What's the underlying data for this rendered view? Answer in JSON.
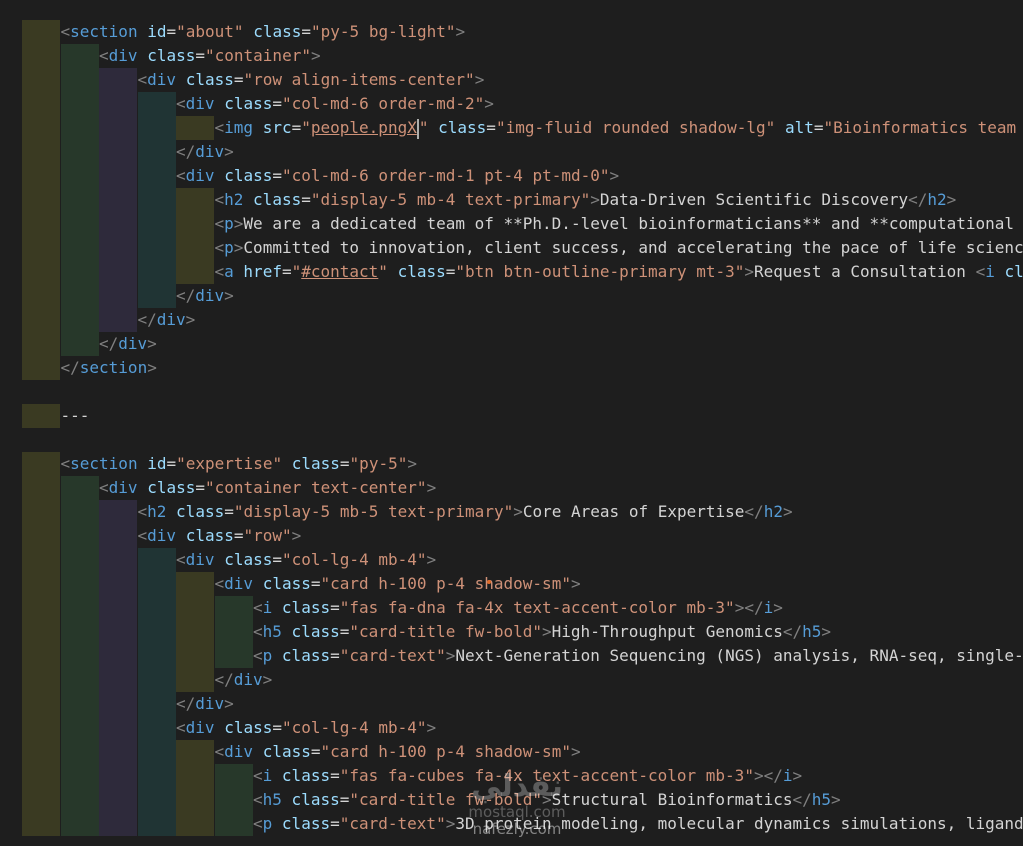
{
  "editor": {
    "lines": [
      {
        "indent": 0,
        "tokens": []
      },
      {
        "indent": 1,
        "tokens": [
          [
            "br",
            "<"
          ],
          [
            "tag",
            "section"
          ],
          [
            "txt",
            " "
          ],
          [
            "attr",
            "id"
          ],
          [
            "txt",
            "="
          ],
          [
            "str",
            "\"about\""
          ],
          [
            "txt",
            " "
          ],
          [
            "attr",
            "class"
          ],
          [
            "txt",
            "="
          ],
          [
            "str",
            "\"py-5 bg-light\""
          ],
          [
            "br",
            ">"
          ]
        ]
      },
      {
        "indent": 2,
        "tokens": [
          [
            "br",
            "<"
          ],
          [
            "tag",
            "div"
          ],
          [
            "txt",
            " "
          ],
          [
            "attr",
            "class"
          ],
          [
            "txt",
            "="
          ],
          [
            "str",
            "\"container\""
          ],
          [
            "br",
            ">"
          ]
        ]
      },
      {
        "indent": 3,
        "tokens": [
          [
            "br",
            "<"
          ],
          [
            "tag",
            "div"
          ],
          [
            "txt",
            " "
          ],
          [
            "attr",
            "class"
          ],
          [
            "txt",
            "="
          ],
          [
            "str",
            "\"row align-items-center\""
          ],
          [
            "br",
            ">"
          ]
        ]
      },
      {
        "indent": 4,
        "tokens": [
          [
            "br",
            "<"
          ],
          [
            "tag",
            "div"
          ],
          [
            "txt",
            " "
          ],
          [
            "attr",
            "class"
          ],
          [
            "txt",
            "="
          ],
          [
            "str",
            "\"col-md-6 order-md-2\""
          ],
          [
            "br",
            ">"
          ]
        ]
      },
      {
        "indent": 5,
        "tokens": [
          [
            "br",
            "<"
          ],
          [
            "tag",
            "img"
          ],
          [
            "txt",
            " "
          ],
          [
            "attr",
            "src"
          ],
          [
            "txt",
            "="
          ],
          [
            "str",
            "\""
          ],
          [
            "stru",
            "people.pngX"
          ],
          [
            "cursor",
            ""
          ],
          [
            "str",
            "\""
          ],
          [
            "txt",
            " "
          ],
          [
            "attr",
            "class"
          ],
          [
            "txt",
            "="
          ],
          [
            "str",
            "\"img-fluid rounded shadow-lg\""
          ],
          [
            "txt",
            " "
          ],
          [
            "attr",
            "alt"
          ],
          [
            "txt",
            "="
          ],
          [
            "str",
            "\"Bioinformatics team w"
          ]
        ]
      },
      {
        "indent": 4,
        "tokens": [
          [
            "br",
            "</"
          ],
          [
            "tag",
            "div"
          ],
          [
            "br",
            ">"
          ]
        ]
      },
      {
        "indent": 4,
        "tokens": [
          [
            "br",
            "<"
          ],
          [
            "tag",
            "div"
          ],
          [
            "txt",
            " "
          ],
          [
            "attr",
            "class"
          ],
          [
            "txt",
            "="
          ],
          [
            "str",
            "\"col-md-6 order-md-1 pt-4 pt-md-0\""
          ],
          [
            "br",
            ">"
          ]
        ]
      },
      {
        "indent": 5,
        "tokens": [
          [
            "br",
            "<"
          ],
          [
            "tag",
            "h2"
          ],
          [
            "txt",
            " "
          ],
          [
            "attr",
            "class"
          ],
          [
            "txt",
            "="
          ],
          [
            "str",
            "\"display-5 mb-4 text-primary\""
          ],
          [
            "br",
            ">"
          ],
          [
            "txt",
            "Data-Driven Scientific Discovery"
          ],
          [
            "br",
            "</"
          ],
          [
            "tag",
            "h2"
          ],
          [
            "br",
            ">"
          ]
        ]
      },
      {
        "indent": 5,
        "tokens": [
          [
            "br",
            "<"
          ],
          [
            "tag",
            "p"
          ],
          [
            "br",
            ">"
          ],
          [
            "txt",
            "We are a dedicated team of **Ph.D.-level bioinformaticians** and **computational"
          ]
        ]
      },
      {
        "indent": 5,
        "tokens": [
          [
            "br",
            "<"
          ],
          [
            "tag",
            "p"
          ],
          [
            "br",
            ">"
          ],
          [
            "txt",
            "Committed to innovation, client success, and accelerating the pace of life science"
          ]
        ]
      },
      {
        "indent": 5,
        "tokens": [
          [
            "br",
            "<"
          ],
          [
            "tag",
            "a"
          ],
          [
            "txt",
            " "
          ],
          [
            "attr",
            "href"
          ],
          [
            "txt",
            "="
          ],
          [
            "str",
            "\""
          ],
          [
            "stru",
            "#contact"
          ],
          [
            "str",
            "\""
          ],
          [
            "txt",
            " "
          ],
          [
            "attr",
            "class"
          ],
          [
            "txt",
            "="
          ],
          [
            "str",
            "\"btn btn-outline-primary mt-3\""
          ],
          [
            "br",
            ">"
          ],
          [
            "txt",
            "Request a Consultation "
          ],
          [
            "br",
            "<"
          ],
          [
            "tag",
            "i"
          ],
          [
            "txt",
            " "
          ],
          [
            "attr",
            "cl"
          ]
        ]
      },
      {
        "indent": 4,
        "tokens": [
          [
            "br",
            "</"
          ],
          [
            "tag",
            "div"
          ],
          [
            "br",
            ">"
          ]
        ]
      },
      {
        "indent": 3,
        "tokens": [
          [
            "br",
            "</"
          ],
          [
            "tag",
            "div"
          ],
          [
            "br",
            ">"
          ]
        ]
      },
      {
        "indent": 2,
        "tokens": [
          [
            "br",
            "</"
          ],
          [
            "tag",
            "div"
          ],
          [
            "br",
            ">"
          ]
        ]
      },
      {
        "indent": 1,
        "tokens": [
          [
            "br",
            "</"
          ],
          [
            "tag",
            "section"
          ],
          [
            "br",
            ">"
          ]
        ]
      },
      {
        "indent": 0,
        "tokens": []
      },
      {
        "indent": 1,
        "tokens": [
          [
            "txt",
            "---"
          ]
        ]
      },
      {
        "indent": 0,
        "tokens": []
      },
      {
        "indent": 1,
        "tokens": [
          [
            "br",
            "<"
          ],
          [
            "tag",
            "section"
          ],
          [
            "txt",
            " "
          ],
          [
            "attr",
            "id"
          ],
          [
            "txt",
            "="
          ],
          [
            "str",
            "\"expertise\""
          ],
          [
            "txt",
            " "
          ],
          [
            "attr",
            "class"
          ],
          [
            "txt",
            "="
          ],
          [
            "str",
            "\"py-5\""
          ],
          [
            "br",
            ">"
          ]
        ]
      },
      {
        "indent": 2,
        "tokens": [
          [
            "br",
            "<"
          ],
          [
            "tag",
            "div"
          ],
          [
            "txt",
            " "
          ],
          [
            "attr",
            "class"
          ],
          [
            "txt",
            "="
          ],
          [
            "str",
            "\"container text-center\""
          ],
          [
            "br",
            ">"
          ]
        ]
      },
      {
        "indent": 3,
        "tokens": [
          [
            "br",
            "<"
          ],
          [
            "tag",
            "h2"
          ],
          [
            "txt",
            " "
          ],
          [
            "attr",
            "class"
          ],
          [
            "txt",
            "="
          ],
          [
            "str",
            "\"display-5 mb-5 text-primary\""
          ],
          [
            "br",
            ">"
          ],
          [
            "txt",
            "Core Areas of Expertise"
          ],
          [
            "br",
            "</"
          ],
          [
            "tag",
            "h2"
          ],
          [
            "br",
            ">"
          ]
        ]
      },
      {
        "indent": 3,
        "tokens": [
          [
            "br",
            "<"
          ],
          [
            "tag",
            "div"
          ],
          [
            "txt",
            " "
          ],
          [
            "attr",
            "class"
          ],
          [
            "txt",
            "="
          ],
          [
            "str",
            "\"row\""
          ],
          [
            "br",
            ">"
          ]
        ]
      },
      {
        "indent": 4,
        "tokens": [
          [
            "br",
            "<"
          ],
          [
            "tag",
            "div"
          ],
          [
            "txt",
            " "
          ],
          [
            "attr",
            "class"
          ],
          [
            "txt",
            "="
          ],
          [
            "str",
            "\"col-lg-4 mb-4\""
          ],
          [
            "br",
            ">"
          ]
        ]
      },
      {
        "indent": 5,
        "tokens": [
          [
            "br",
            "<"
          ],
          [
            "tag",
            "div"
          ],
          [
            "txt",
            " "
          ],
          [
            "attr",
            "class"
          ],
          [
            "txt",
            "="
          ],
          [
            "str",
            "\"card h-100 p-4 shadow-sm\""
          ],
          [
            "br",
            ">"
          ]
        ]
      },
      {
        "indent": 6,
        "tokens": [
          [
            "br",
            "<"
          ],
          [
            "tag",
            "i"
          ],
          [
            "txt",
            " "
          ],
          [
            "attr",
            "class"
          ],
          [
            "txt",
            "="
          ],
          [
            "str",
            "\"fas fa-dna fa-4x text-accent-color mb-3\""
          ],
          [
            "br",
            "></"
          ],
          [
            "tag",
            "i"
          ],
          [
            "br",
            ">"
          ]
        ]
      },
      {
        "indent": 6,
        "tokens": [
          [
            "br",
            "<"
          ],
          [
            "tag",
            "h5"
          ],
          [
            "txt",
            " "
          ],
          [
            "attr",
            "class"
          ],
          [
            "txt",
            "="
          ],
          [
            "str",
            "\"card-title fw-bold\""
          ],
          [
            "br",
            ">"
          ],
          [
            "txt",
            "High-Throughput Genomics"
          ],
          [
            "br",
            "</"
          ],
          [
            "tag",
            "h5"
          ],
          [
            "br",
            ">"
          ]
        ]
      },
      {
        "indent": 6,
        "tokens": [
          [
            "br",
            "<"
          ],
          [
            "tag",
            "p"
          ],
          [
            "txt",
            " "
          ],
          [
            "attr",
            "class"
          ],
          [
            "txt",
            "="
          ],
          [
            "str",
            "\"card-text\""
          ],
          [
            "br",
            ">"
          ],
          [
            "txt",
            "Next-Generation Sequencing (NGS) analysis, RNA-seq, single-"
          ]
        ]
      },
      {
        "indent": 5,
        "tokens": [
          [
            "br",
            "</"
          ],
          [
            "tag",
            "div"
          ],
          [
            "br",
            ">"
          ]
        ]
      },
      {
        "indent": 4,
        "tokens": [
          [
            "br",
            "</"
          ],
          [
            "tag",
            "div"
          ],
          [
            "br",
            ">"
          ]
        ]
      },
      {
        "indent": 4,
        "tokens": [
          [
            "br",
            "<"
          ],
          [
            "tag",
            "div"
          ],
          [
            "txt",
            " "
          ],
          [
            "attr",
            "class"
          ],
          [
            "txt",
            "="
          ],
          [
            "str",
            "\"col-lg-4 mb-4\""
          ],
          [
            "br",
            ">"
          ]
        ]
      },
      {
        "indent": 5,
        "tokens": [
          [
            "br",
            "<"
          ],
          [
            "tag",
            "div"
          ],
          [
            "txt",
            " "
          ],
          [
            "attr",
            "class"
          ],
          [
            "txt",
            "="
          ],
          [
            "str",
            "\"card h-100 p-4 shadow-sm\""
          ],
          [
            "br",
            ">"
          ]
        ]
      },
      {
        "indent": 6,
        "tokens": [
          [
            "br",
            "<"
          ],
          [
            "tag",
            "i"
          ],
          [
            "txt",
            " "
          ],
          [
            "attr",
            "class"
          ],
          [
            "txt",
            "="
          ],
          [
            "str",
            "\"fas fa-cubes fa-4x text-accent-color mb-3\""
          ],
          [
            "br",
            "></"
          ],
          [
            "tag",
            "i"
          ],
          [
            "br",
            ">"
          ]
        ]
      },
      {
        "indent": 6,
        "tokens": [
          [
            "br",
            "<"
          ],
          [
            "tag",
            "h5"
          ],
          [
            "txt",
            " "
          ],
          [
            "attr",
            "class"
          ],
          [
            "txt",
            "="
          ],
          [
            "str",
            "\"card-title fw-bold\""
          ],
          [
            "br",
            ">"
          ],
          [
            "txt",
            "Structural Bioinformatics"
          ],
          [
            "br",
            "</"
          ],
          [
            "tag",
            "h5"
          ],
          [
            "br",
            ">"
          ]
        ]
      },
      {
        "indent": 6,
        "tokens": [
          [
            "br",
            "<"
          ],
          [
            "tag",
            "p"
          ],
          [
            "txt",
            " "
          ],
          [
            "attr",
            "class"
          ],
          [
            "txt",
            "="
          ],
          [
            "str",
            "\"card-text\""
          ],
          [
            "br",
            ">"
          ],
          [
            "txt",
            "3D protein modeling, molecular dynamics simulations, ligand"
          ]
        ]
      }
    ]
  },
  "watermark": {
    "logo": "نفذلي",
    "site1": "mostaql.com",
    "site2": "nafezly.com"
  }
}
